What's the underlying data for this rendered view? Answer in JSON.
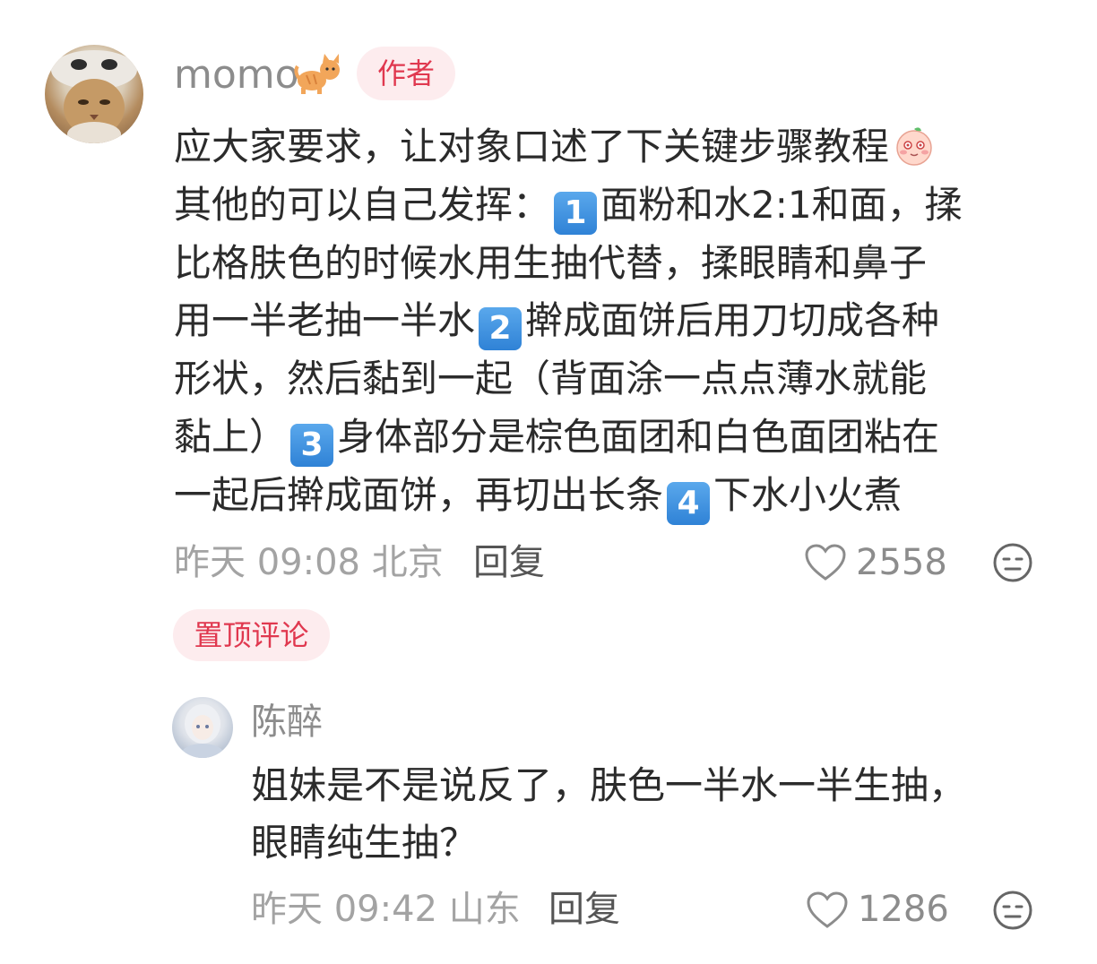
{
  "comment": {
    "username": "momo",
    "username_emoji": "cat-emoji",
    "author_badge": "作者",
    "text_line1": "应大家要求，让对象口述了下关键步骤教程",
    "text_line2_a": "其他的可以自己发挥：",
    "text_line2_b": "面粉和水2:1和面，揉",
    "text_line3": "比格肤色的时候水用生抽代替，揉眼睛和鼻子",
    "text_line4_a": "用一半老抽一半水",
    "text_line4_b": "擀成面饼后用刀切成各种",
    "text_line5": "形状，然后黏到一起（背面涂一点点薄水就能",
    "text_line6_a": "黏上）",
    "text_line6_b": "身体部分是棕色面团和白色面团粘在",
    "text_line7_a": "一起后擀成面饼，再切出长条",
    "text_line7_b": "下水小火煮",
    "step_keys": [
      "1",
      "2",
      "3",
      "4"
    ],
    "time": "昨天 09:08 北京",
    "reply_label": "回复",
    "like_count": "2558",
    "pinned_label": "置顶评论"
  },
  "reply": {
    "username": "陈醉",
    "text_line1": "姐妹是不是说反了，肤色一半水一半生抽，",
    "text_line2": "眼睛纯生抽？",
    "time": "昨天 09:42 山东",
    "reply_label": "回复",
    "like_count": "1286"
  },
  "colors": {
    "badge_bg": "#fdecee",
    "badge_text": "#e0384f",
    "key_blue": "#2f82d6",
    "muted_text": "#a3a3a3"
  }
}
